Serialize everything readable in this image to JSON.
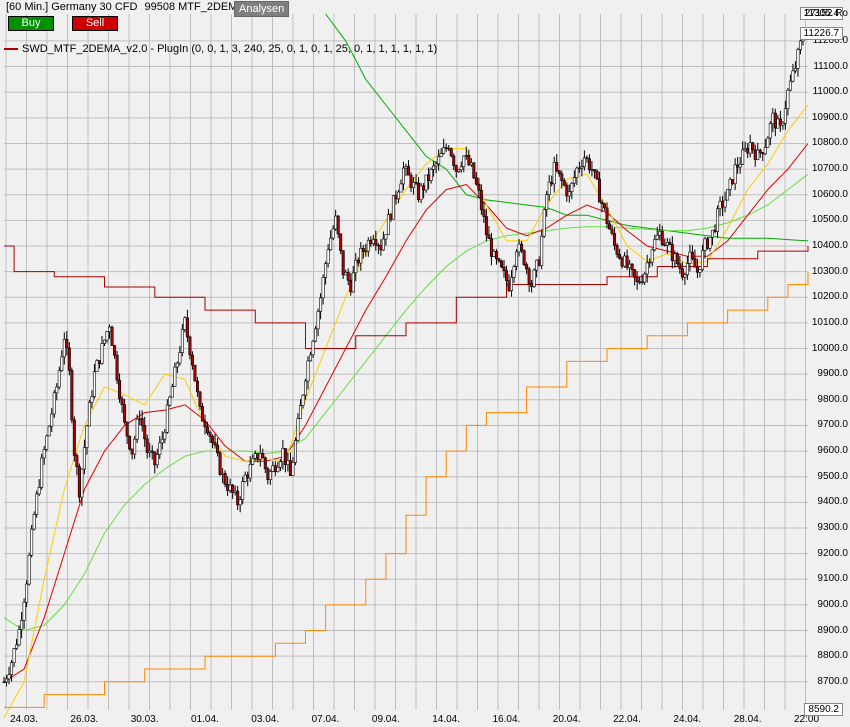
{
  "header": {
    "instrument": "[60 Min.] Germany 30 CFD",
    "account": "99508 MTF_2DEMA",
    "analysen_label": "Analysen"
  },
  "toolbar": {
    "buy_label": "Buy",
    "sell_label": "Sell"
  },
  "indicator_label": "SWD_MTF_2DEMA_v2.0 - PlugIn  (0, 0, 1, 3, 240, 25, 0, 1, 0, 1, 25, 0, 1, 1, 1, 1, 1, 1)",
  "colors": {
    "up": "#ffffff",
    "down": "#aa0000",
    "grid": "#bfbfbf",
    "bg": "#f0f0f0"
  },
  "chart_data": {
    "type": "candlestick",
    "y_axis_top_label": "27152 Ro",
    "ylim": [
      8590,
      11305
    ],
    "y_ticks": [
      8700,
      8800,
      8900,
      9000,
      9100,
      9200,
      9300,
      9400,
      9500,
      9600,
      9700,
      9800,
      9900,
      10000,
      10100,
      10200,
      10300,
      10400,
      10500,
      10600,
      10700,
      10800,
      10900,
      11000,
      11100,
      11200
    ],
    "y_tick_labels": [
      "8700.0",
      "8800.0",
      "8900.0",
      "9000.0",
      "9100.0",
      "9200.0",
      "9300.0",
      "9400.0",
      "9500.0",
      "9600.0",
      "9700.0",
      "9800.0",
      "9900.0",
      "10000.0",
      "10100.0",
      "10200.0",
      "10300.0",
      "10400.0",
      "10500.0",
      "10600.0",
      "10700.0",
      "10800.0",
      "10900.0",
      "11000.0",
      "11100.0",
      "11200.0"
    ],
    "price_tags": [
      {
        "label": "11305.4",
        "value": 11305.4
      },
      {
        "label": "11226.7",
        "value": 11226.7
      },
      {
        "label": "8590.2",
        "value": 8590.2
      }
    ],
    "x_labels": [
      "24.03.",
      "26.03.",
      "30.03.",
      "01.04.",
      "03.04.",
      "07.04.",
      "09.04.",
      "14.04.",
      "16.04.",
      "20.04.",
      "22.04.",
      "24.04.",
      "28.04.",
      "22:00"
    ],
    "x_label_index": [
      8,
      32,
      56,
      80,
      104,
      128,
      152,
      176,
      200,
      224,
      248,
      272,
      296,
      320
    ],
    "candles_close_path": [
      [
        0,
        8700
      ],
      [
        3,
        8780
      ],
      [
        6,
        8900
      ],
      [
        9,
        9100
      ],
      [
        12,
        9350
      ],
      [
        15,
        9550
      ],
      [
        18,
        9700
      ],
      [
        21,
        9850
      ],
      [
        24,
        10050
      ],
      [
        26,
        9900
      ],
      [
        28,
        9600
      ],
      [
        30,
        9450
      ],
      [
        33,
        9700
      ],
      [
        36,
        9900
      ],
      [
        39,
        10000
      ],
      [
        42,
        10100
      ],
      [
        45,
        9900
      ],
      [
        48,
        9700
      ],
      [
        51,
        9600
      ],
      [
        54,
        9750
      ],
      [
        57,
        9600
      ],
      [
        60,
        9550
      ],
      [
        63,
        9650
      ],
      [
        66,
        9800
      ],
      [
        69,
        9950
      ],
      [
        72,
        10100
      ],
      [
        75,
        9950
      ],
      [
        78,
        9750
      ],
      [
        81,
        9700
      ],
      [
        84,
        9600
      ],
      [
        87,
        9500
      ],
      [
        90,
        9450
      ],
      [
        93,
        9400
      ],
      [
        96,
        9500
      ],
      [
        99,
        9550
      ],
      [
        102,
        9600
      ],
      [
        105,
        9500
      ],
      [
        108,
        9550
      ],
      [
        111,
        9600
      ],
      [
        114,
        9500
      ],
      [
        117,
        9700
      ],
      [
        120,
        9900
      ],
      [
        123,
        10050
      ],
      [
        126,
        10200
      ],
      [
        129,
        10400
      ],
      [
        132,
        10500
      ],
      [
        135,
        10300
      ],
      [
        138,
        10250
      ],
      [
        141,
        10350
      ],
      [
        144,
        10400
      ],
      [
        147,
        10450
      ],
      [
        150,
        10400
      ],
      [
        153,
        10500
      ],
      [
        156,
        10600
      ],
      [
        159,
        10700
      ],
      [
        162,
        10650
      ],
      [
        165,
        10600
      ],
      [
        168,
        10650
      ],
      [
        171,
        10700
      ],
      [
        174,
        10750
      ],
      [
        177,
        10800
      ],
      [
        180,
        10700
      ],
      [
        183,
        10750
      ],
      [
        186,
        10700
      ],
      [
        189,
        10600
      ],
      [
        192,
        10450
      ],
      [
        195,
        10350
      ],
      [
        198,
        10300
      ],
      [
        201,
        10250
      ],
      [
        204,
        10400
      ],
      [
        207,
        10350
      ],
      [
        210,
        10250
      ],
      [
        213,
        10350
      ],
      [
        216,
        10600
      ],
      [
        219,
        10700
      ],
      [
        222,
        10650
      ],
      [
        225,
        10600
      ],
      [
        228,
        10700
      ],
      [
        231,
        10750
      ],
      [
        234,
        10700
      ],
      [
        237,
        10600
      ],
      [
        240,
        10500
      ],
      [
        243,
        10400
      ],
      [
        246,
        10350
      ],
      [
        249,
        10300
      ],
      [
        252,
        10250
      ],
      [
        255,
        10300
      ],
      [
        258,
        10400
      ],
      [
        261,
        10450
      ],
      [
        264,
        10400
      ],
      [
        267,
        10350
      ],
      [
        270,
        10300
      ],
      [
        273,
        10350
      ],
      [
        276,
        10300
      ],
      [
        279,
        10400
      ],
      [
        282,
        10450
      ],
      [
        285,
        10550
      ],
      [
        288,
        10600
      ],
      [
        291,
        10700
      ],
      [
        294,
        10750
      ],
      [
        297,
        10800
      ],
      [
        300,
        10750
      ],
      [
        303,
        10800
      ],
      [
        306,
        10900
      ],
      [
        309,
        10850
      ],
      [
        312,
        11000
      ],
      [
        315,
        11100
      ],
      [
        318,
        11226
      ]
    ],
    "series": [
      {
        "color": "#00aa00",
        "points": [
          [
            128,
            11305
          ],
          [
            136,
            11200
          ],
          [
            144,
            11050
          ],
          [
            152,
            10950
          ],
          [
            160,
            10850
          ],
          [
            168,
            10750
          ],
          [
            176,
            10700
          ],
          [
            184,
            10600
          ],
          [
            192,
            10580
          ],
          [
            200,
            10570
          ],
          [
            208,
            10560
          ],
          [
            216,
            10550
          ],
          [
            224,
            10520
          ],
          [
            232,
            10520
          ],
          [
            240,
            10500
          ],
          [
            248,
            10480
          ],
          [
            256,
            10470
          ],
          [
            264,
            10460
          ],
          [
            272,
            10450
          ],
          [
            280,
            10440
          ],
          [
            288,
            10430
          ],
          [
            296,
            10430
          ],
          [
            304,
            10430
          ],
          [
            312,
            10425
          ],
          [
            320,
            10420
          ]
        ]
      },
      {
        "color": "#66dd44",
        "points": [
          [
            0,
            8950
          ],
          [
            8,
            8900
          ],
          [
            16,
            8920
          ],
          [
            24,
            9000
          ],
          [
            32,
            9120
          ],
          [
            40,
            9280
          ],
          [
            48,
            9390
          ],
          [
            56,
            9470
          ],
          [
            64,
            9530
          ],
          [
            72,
            9580
          ],
          [
            80,
            9600
          ],
          [
            88,
            9600
          ],
          [
            96,
            9600
          ],
          [
            104,
            9590
          ],
          [
            112,
            9600
          ],
          [
            120,
            9650
          ],
          [
            128,
            9750
          ],
          [
            136,
            9850
          ],
          [
            144,
            9950
          ],
          [
            152,
            10050
          ],
          [
            160,
            10150
          ],
          [
            168,
            10240
          ],
          [
            176,
            10320
          ],
          [
            184,
            10380
          ],
          [
            192,
            10420
          ],
          [
            200,
            10440
          ],
          [
            208,
            10450
          ],
          [
            216,
            10460
          ],
          [
            224,
            10470
          ],
          [
            232,
            10475
          ],
          [
            240,
            10475
          ],
          [
            248,
            10470
          ],
          [
            256,
            10465
          ],
          [
            264,
            10460
          ],
          [
            272,
            10460
          ],
          [
            280,
            10470
          ],
          [
            288,
            10490
          ],
          [
            296,
            10520
          ],
          [
            304,
            10560
          ],
          [
            312,
            10620
          ],
          [
            320,
            10680
          ]
        ]
      },
      {
        "color": "#e00000",
        "points": [
          [
            0,
            8700
          ],
          [
            8,
            8750
          ],
          [
            16,
            8950
          ],
          [
            24,
            9200
          ],
          [
            32,
            9450
          ],
          [
            40,
            9600
          ],
          [
            48,
            9700
          ],
          [
            56,
            9750
          ],
          [
            64,
            9760
          ],
          [
            72,
            9780
          ],
          [
            80,
            9720
          ],
          [
            88,
            9620
          ],
          [
            96,
            9560
          ],
          [
            104,
            9560
          ],
          [
            112,
            9580
          ],
          [
            120,
            9700
          ],
          [
            128,
            9850
          ],
          [
            136,
            10000
          ],
          [
            144,
            10150
          ],
          [
            152,
            10280
          ],
          [
            160,
            10420
          ],
          [
            168,
            10540
          ],
          [
            176,
            10620
          ],
          [
            184,
            10640
          ],
          [
            192,
            10560
          ],
          [
            200,
            10470
          ],
          [
            208,
            10440
          ],
          [
            216,
            10470
          ],
          [
            224,
            10520
          ],
          [
            232,
            10560
          ],
          [
            240,
            10530
          ],
          [
            248,
            10460
          ],
          [
            256,
            10400
          ],
          [
            264,
            10380
          ],
          [
            272,
            10360
          ],
          [
            280,
            10360
          ],
          [
            288,
            10420
          ],
          [
            296,
            10520
          ],
          [
            304,
            10620
          ],
          [
            312,
            10700
          ],
          [
            320,
            10800
          ]
        ]
      },
      {
        "color": "#ffcc00",
        "points": [
          [
            0,
            8560
          ],
          [
            8,
            8700
          ],
          [
            16,
            9100
          ],
          [
            24,
            9450
          ],
          [
            32,
            9700
          ],
          [
            40,
            9850
          ],
          [
            48,
            9820
          ],
          [
            56,
            9780
          ],
          [
            64,
            9900
          ],
          [
            72,
            9880
          ],
          [
            80,
            9700
          ],
          [
            88,
            9580
          ],
          [
            96,
            9560
          ],
          [
            104,
            9570
          ],
          [
            112,
            9560
          ],
          [
            120,
            9800
          ],
          [
            128,
            10000
          ],
          [
            136,
            10200
          ],
          [
            144,
            10380
          ],
          [
            152,
            10500
          ],
          [
            160,
            10620
          ],
          [
            168,
            10720
          ],
          [
            176,
            10780
          ],
          [
            184,
            10780
          ],
          [
            192,
            10560
          ],
          [
            200,
            10420
          ],
          [
            208,
            10420
          ],
          [
            216,
            10560
          ],
          [
            224,
            10660
          ],
          [
            232,
            10680
          ],
          [
            240,
            10550
          ],
          [
            248,
            10400
          ],
          [
            256,
            10340
          ],
          [
            264,
            10370
          ],
          [
            272,
            10330
          ],
          [
            280,
            10340
          ],
          [
            288,
            10470
          ],
          [
            296,
            10620
          ],
          [
            304,
            10720
          ],
          [
            312,
            10850
          ],
          [
            320,
            10950
          ]
        ]
      },
      {
        "color": "#aa0000",
        "steps": [
          [
            0,
            10400
          ],
          [
            4,
            10300
          ],
          [
            20,
            10280
          ],
          [
            40,
            10240
          ],
          [
            60,
            10200
          ],
          [
            80,
            10150
          ],
          [
            100,
            10100
          ],
          [
            120,
            10000
          ],
          [
            140,
            10050
          ],
          [
            160,
            10100
          ],
          [
            180,
            10200
          ],
          [
            200,
            10250
          ],
          [
            220,
            10250
          ],
          [
            240,
            10280
          ],
          [
            260,
            10320
          ],
          [
            280,
            10350
          ],
          [
            300,
            10380
          ],
          [
            320,
            10400
          ]
        ]
      },
      {
        "color": "#ff8800",
        "steps": [
          [
            0,
            8600
          ],
          [
            16,
            8650
          ],
          [
            40,
            8700
          ],
          [
            56,
            8750
          ],
          [
            80,
            8800
          ],
          [
            96,
            8800
          ],
          [
            108,
            8850
          ],
          [
            120,
            8900
          ],
          [
            128,
            9000
          ],
          [
            144,
            9100
          ],
          [
            152,
            9200
          ],
          [
            160,
            9350
          ],
          [
            168,
            9500
          ],
          [
            176,
            9600
          ],
          [
            184,
            9700
          ],
          [
            192,
            9750
          ],
          [
            208,
            9850
          ],
          [
            224,
            9950
          ],
          [
            240,
            10000
          ],
          [
            256,
            10050
          ],
          [
            272,
            10100
          ],
          [
            288,
            10150
          ],
          [
            304,
            10200
          ],
          [
            312,
            10250
          ],
          [
            320,
            10300
          ]
        ]
      }
    ]
  }
}
